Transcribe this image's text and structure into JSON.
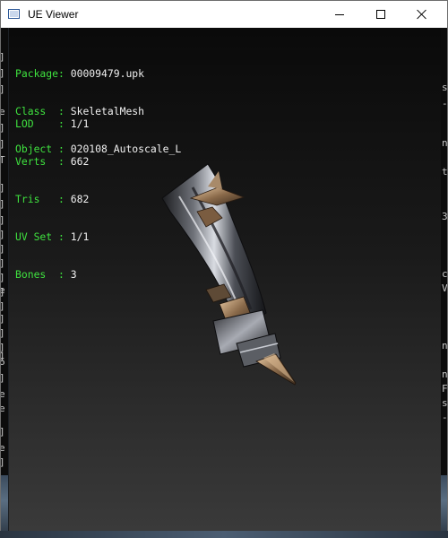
{
  "window": {
    "title": "UE Viewer"
  },
  "info": {
    "package_label": "Package: ",
    "package_value": "00009479.upk",
    "class_label": "Class  : ",
    "class_value": "SkeletalMesh",
    "object_label": "Object : ",
    "object_value": "020108_Autoscale_L",
    "lod_label": "LOD    : ",
    "lod_value": "1/1",
    "verts_label": "Verts  : ",
    "verts_value": "662",
    "tris_label": "Tris   : ",
    "tris_value": "682",
    "uvset_label": "UV Set : ",
    "uvset_value": "1/1",
    "bones_label": "Bones  : ",
    "bones_value": "3"
  },
  "background_console": {
    "left_chars": [
      "]",
      "]",
      "]",
      "e",
      "]",
      "]",
      "T",
      "]",
      "]",
      "]",
      "]",
      "]",
      "]",
      "]",
      "]",
      "]",
      "e",
      "]",
      "]",
      "]",
      "]",
      "6",
      "]",
      "e",
      "e",
      "]",
      "e",
      "]"
    ],
    "right_chars": [
      "s",
      "-",
      "n",
      "t",
      "3",
      "c",
      "V",
      "n",
      "n",
      "F",
      "s",
      "-"
    ]
  },
  "colors": {
    "label_green": "#3fe23f",
    "value_white": "#f0f0f0",
    "viewport_top": "#0a0a0a",
    "viewport_bottom": "#3a3a3a"
  },
  "icons": {
    "app": "window-app-icon",
    "minimize": "minimize-icon",
    "maximize": "maximize-icon",
    "close": "close-icon"
  }
}
